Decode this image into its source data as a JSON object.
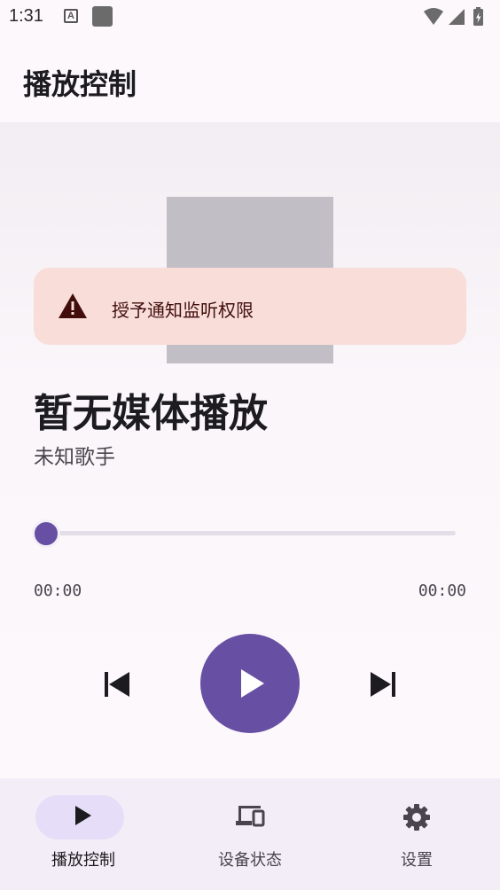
{
  "status_bar": {
    "time": "1:31",
    "icons": [
      "keyboard-a-icon",
      "app-square-icon",
      "wifi-icon",
      "signal-icon",
      "battery-icon"
    ]
  },
  "app_bar": {
    "title": "播放控制"
  },
  "player": {
    "permission_banner": {
      "icon": "warning-icon",
      "text": "授予通知监听权限"
    },
    "track_title": "暂无媒体播放",
    "track_artist": "未知歌手",
    "progress": 0,
    "time_current": "00:00",
    "time_total": "00:00",
    "controls": {
      "previous": "skip-previous-icon",
      "play": "play-icon",
      "next": "skip-next-icon"
    }
  },
  "bottom_nav": {
    "items": [
      {
        "label": "播放控制",
        "icon": "play-icon",
        "active": true
      },
      {
        "label": "设备状态",
        "icon": "devices-icon",
        "active": false
      },
      {
        "label": "设置",
        "icon": "gear-icon",
        "active": false
      }
    ]
  },
  "colors": {
    "primary": "#6750a4",
    "banner_bg": "#f8ddd9",
    "banner_text": "#410e0b",
    "nav_bg": "#f3edf7",
    "nav_indicator": "#e6def8",
    "album_placeholder": "#c2bec5"
  }
}
